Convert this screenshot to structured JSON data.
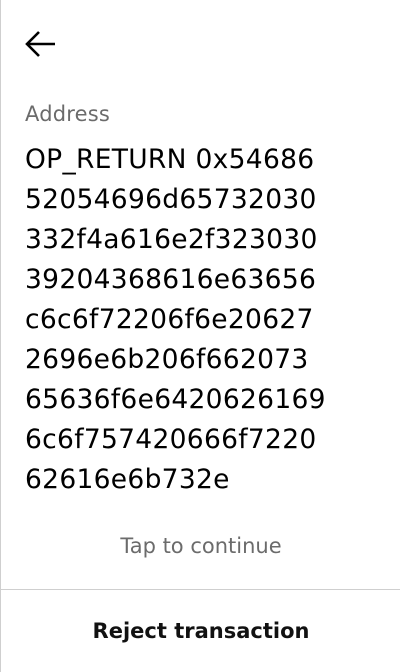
{
  "header": {
    "back_icon": "arrow-left-icon"
  },
  "address": {
    "label": "Address",
    "lines": [
      "OP_RETURN 0x54686",
      "52054696d65732030",
      "332f4a616e2f323030",
      "39204368616e63656",
      "c6c6f72206f6e20627",
      "2696e6b206f662073",
      "65636f6e6420626169",
      "6c6f757420666f7220",
      "62616e6b732e"
    ]
  },
  "footer": {
    "tap_hint": "Tap to continue",
    "reject_label": "Reject transaction"
  },
  "colors": {
    "text": "#000000",
    "muted": "#6b6b6b",
    "divider": "#cfcfcf",
    "background": "#ffffff"
  }
}
